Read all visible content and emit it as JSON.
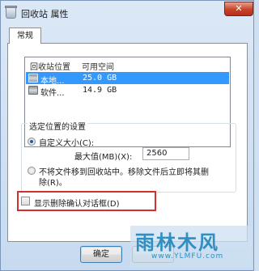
{
  "window": {
    "title": "回收站 属性",
    "close_label": "✕"
  },
  "tabs": [
    {
      "label": "常规"
    }
  ],
  "listview": {
    "columns": [
      "回收站位置",
      "可用空间"
    ],
    "rows": [
      {
        "location": "本地...",
        "space": "25.0 GB",
        "selected": true
      },
      {
        "location": "软件...",
        "space": "14.9 GB",
        "selected": false
      }
    ]
  },
  "settings": {
    "group_label": "选定位置的设置",
    "custom_size_label": "自定义大小(C):",
    "max_value_label": "最大值(MB)(X):",
    "max_value": "2560",
    "no_move_label_line1": "不将文件移到回收站中。移除文件后立即将其删",
    "no_move_label_line2": "除(R)。",
    "custom_checked": true
  },
  "confirm": {
    "label": "显示删除确认对话框(D)",
    "checked": false
  },
  "buttons": {
    "ok": "确定"
  },
  "watermark": {
    "logo": "雨林木风",
    "url": "www.YLMFU.com"
  },
  "colors": {
    "selection": "#3399ff",
    "highlight_border": "#d03030",
    "close_button": "#c7412a"
  }
}
